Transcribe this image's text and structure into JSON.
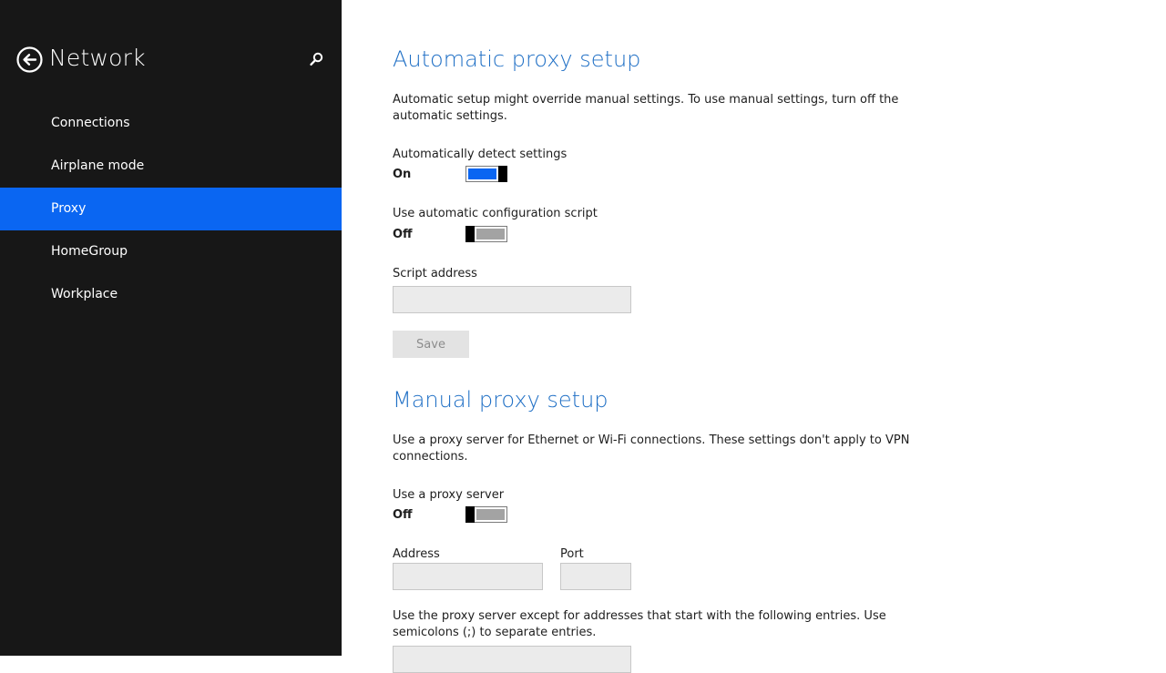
{
  "sidebar": {
    "back_icon": "back-arrow-icon",
    "title": "Network",
    "search_icon": "search-icon",
    "items": [
      {
        "label": "Connections",
        "selected": false
      },
      {
        "label": "Airplane mode",
        "selected": false
      },
      {
        "label": "Proxy",
        "selected": true
      },
      {
        "label": "HomeGroup",
        "selected": false
      },
      {
        "label": "Workplace",
        "selected": false
      }
    ]
  },
  "automatic": {
    "title": "Automatic proxy setup",
    "description": "Automatic setup might override manual settings. To use manual settings, turn off the automatic settings.",
    "detect": {
      "label": "Automatically detect settings",
      "state": "On"
    },
    "script": {
      "label": "Use automatic configuration script",
      "state": "Off"
    },
    "script_address": {
      "label": "Script address",
      "value": "",
      "placeholder": ""
    },
    "save_label": "Save"
  },
  "manual": {
    "title": "Manual proxy setup",
    "description": "Use a proxy server for Ethernet or Wi-Fi connections. These settings don't apply to VPN connections.",
    "use_proxy": {
      "label": "Use a proxy server",
      "state": "Off"
    },
    "address": {
      "label": "Address",
      "value": ""
    },
    "port": {
      "label": "Port",
      "value": ""
    },
    "exceptions": {
      "description": "Use the proxy server except for addresses that start with the following entries. Use semicolons (;) to separate entries.",
      "value": ""
    }
  },
  "colors": {
    "sidebar_bg": "#171717",
    "accent": "#0a66f2",
    "heading": "#1f6fc5"
  }
}
